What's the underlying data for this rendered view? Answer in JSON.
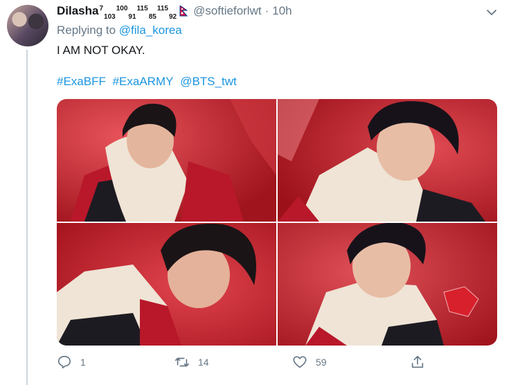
{
  "tweet": {
    "display_name": "Dilasha",
    "name_glyphs": [
      "7",
      "103",
      "100",
      "91",
      "115",
      "85",
      "115",
      "92"
    ],
    "handle": "@softieforlwt",
    "separator": "·",
    "time": "10h",
    "replying_prefix": "Replying to",
    "replying_to": "@fila_korea",
    "text": "I AM NOT OKAY.",
    "hashtags": [
      "#ExaBFF",
      "#ExaARMY",
      "@BTS_twt"
    ]
  },
  "media": {
    "count": 4,
    "background_color": "#c8202a",
    "hoodie_color": "#efe4d6"
  },
  "actions": {
    "reply_count": "1",
    "retweet_count": "14",
    "like_count": "59",
    "icon_color": "#657786"
  },
  "icons": [
    "reply-icon",
    "retweet-icon",
    "like-icon",
    "share-icon",
    "chevron-down-icon",
    "nepal-flag-icon"
  ]
}
